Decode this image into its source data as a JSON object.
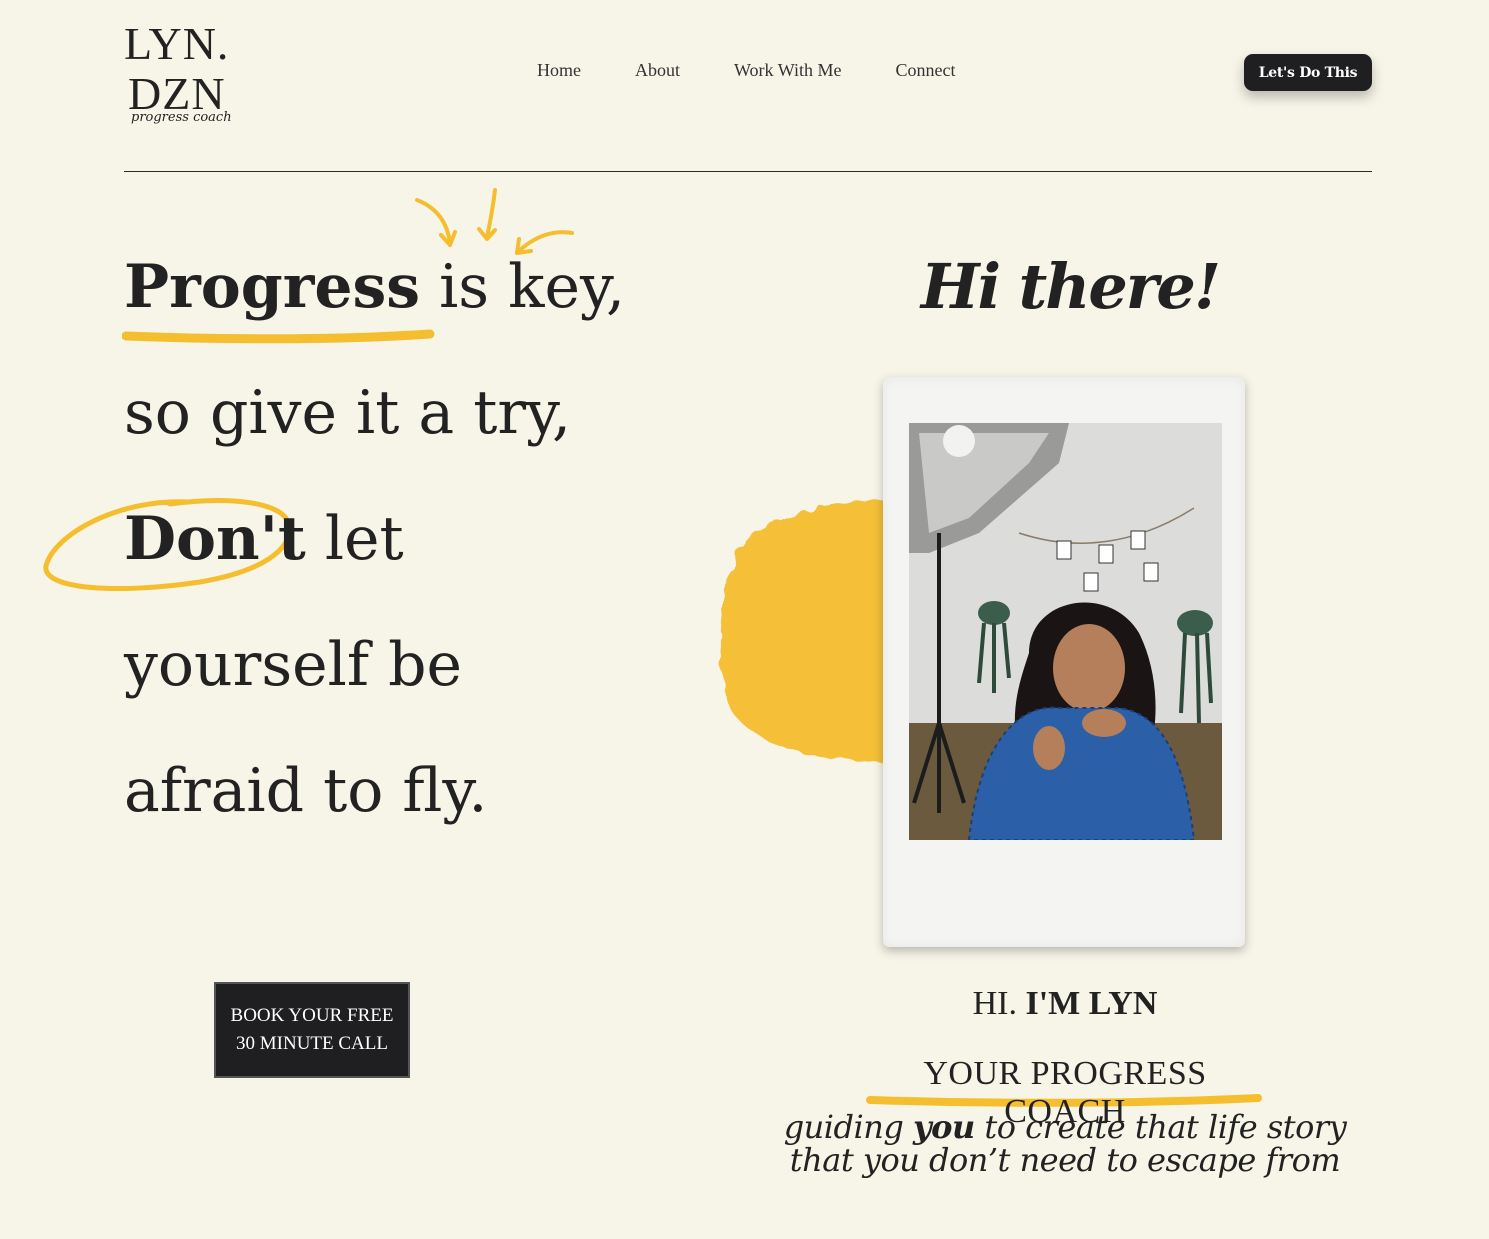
{
  "logo": {
    "line1": "LYN.",
    "line2": "DZN",
    "tagline": "progress coach"
  },
  "nav": {
    "items": [
      "Home",
      "About",
      "Work With Me",
      "Connect"
    ]
  },
  "header_cta": "Let's Do This",
  "headline": {
    "w_progress": "Progress",
    "w_is": " is",
    "w_key": " key,",
    "line2": "so give it a try,",
    "w_dont": "Don't",
    "w_let": "let",
    "line4": "yourself be",
    "line5": "afraid to fly."
  },
  "book_button": {
    "line1": "BOOK YOUR FREE",
    "line2": "30 MINUTE CALL"
  },
  "greeting": "Hi there!",
  "intro": {
    "hi": "HI.",
    "name": "I'M LYN",
    "role": "YOUR PROGRESS COACH"
  },
  "tagline": {
    "part1": "guiding ",
    "emph": "you",
    "part2": " to create that life story",
    "line2": "that you don’t need to escape from"
  },
  "colors": {
    "accent": "#f5be2f",
    "dark": "#1f1f21",
    "background": "#f7f4e8"
  }
}
